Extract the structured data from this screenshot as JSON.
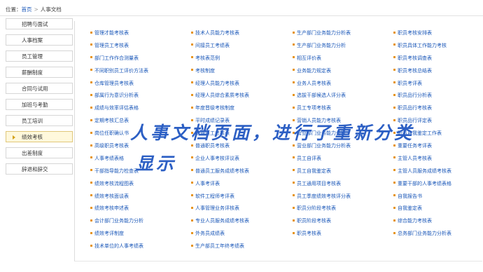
{
  "breadcrumb": {
    "prefix": "位置：",
    "home": "首页",
    "sep": ">",
    "current": "人事文档"
  },
  "sidebar": {
    "items": [
      {
        "label": "招聘与面试"
      },
      {
        "label": "人事档案"
      },
      {
        "label": "员工管理"
      },
      {
        "label": "薪酬制度"
      },
      {
        "label": "合同与试用"
      },
      {
        "label": "加班与考勤"
      },
      {
        "label": "员工培训"
      },
      {
        "label": "绩效考核",
        "active": true
      },
      {
        "label": "出差制度"
      },
      {
        "label": "辞退和辞交"
      }
    ]
  },
  "columns": [
    [
      "管理才能考核表",
      "管理员工考核表",
      "部门工作作合测量表",
      "不同职别员工评价方法表",
      "仓库管理员考核表",
      "部属行为意识分析表",
      "成绩与效率评估表格",
      "定期考核汇总表",
      "岗位任职确认书",
      "高级职员考核表",
      "人事考绩表格",
      "干部指导能力检查表",
      "绩效考核流程图表",
      "绩效考核面谈表",
      "绩效考核申述表",
      "会计部门业务能力分析",
      "绩效考评制度",
      "技术单位的人事考绩表"
    ],
    [
      "技术人员能力考核表",
      "间接员工考绩表",
      "考核表范例",
      "考核制度",
      "经理人员能力考核表",
      "经理人员综合素质考核表",
      "年度晋级考核制度",
      "平时成绩记录表",
      "普通员工考核表",
      "普通职员考核表",
      "企业人事考核评议表",
      "普通员工服务成绩考核表",
      "人事考评表",
      "软件工程师考评表",
      "人事管理业务评核表",
      "专业人员服务成绩考核表",
      "外务员成绩表",
      "生产部员工年终考绩表"
    ],
    [
      "生产部门业务能力分析表",
      "生产部门业务能力分析",
      "相互评价表",
      "业务能力规定表",
      "业务人员考核表",
      "选拔干部候选人评分表",
      "员工专项考核表",
      "营销人员能力考核表",
      "营业部门业务能力分析",
      "营业部门业务能力分析表",
      "员工自评表",
      "员工自我鉴定表",
      "员工通用项目考核表",
      "员工季度绩效考核评分表",
      "职员分阶段考核表",
      "职员阶段考核表",
      "职员考核表"
    ],
    [
      "职员考核安排表",
      "职员具体工作能力考核",
      "职员考核调查表",
      "职员考核总结表",
      "职员考评表",
      "职员品行分析表",
      "职员品行考核表",
      "职员品行评定表",
      "职员自我鉴定工作表",
      "重要任务考评表",
      "主管人员考核表",
      "主管人员服务成绩考核表",
      "重要干部的人事考绩表格",
      "自我报告书",
      "自我鉴定表",
      "综合能力考核表",
      "总务部门业务能力分析表"
    ]
  ],
  "overlay": {
    "line1": "人事文档页面，进行了重新分类",
    "line2": "显示"
  }
}
